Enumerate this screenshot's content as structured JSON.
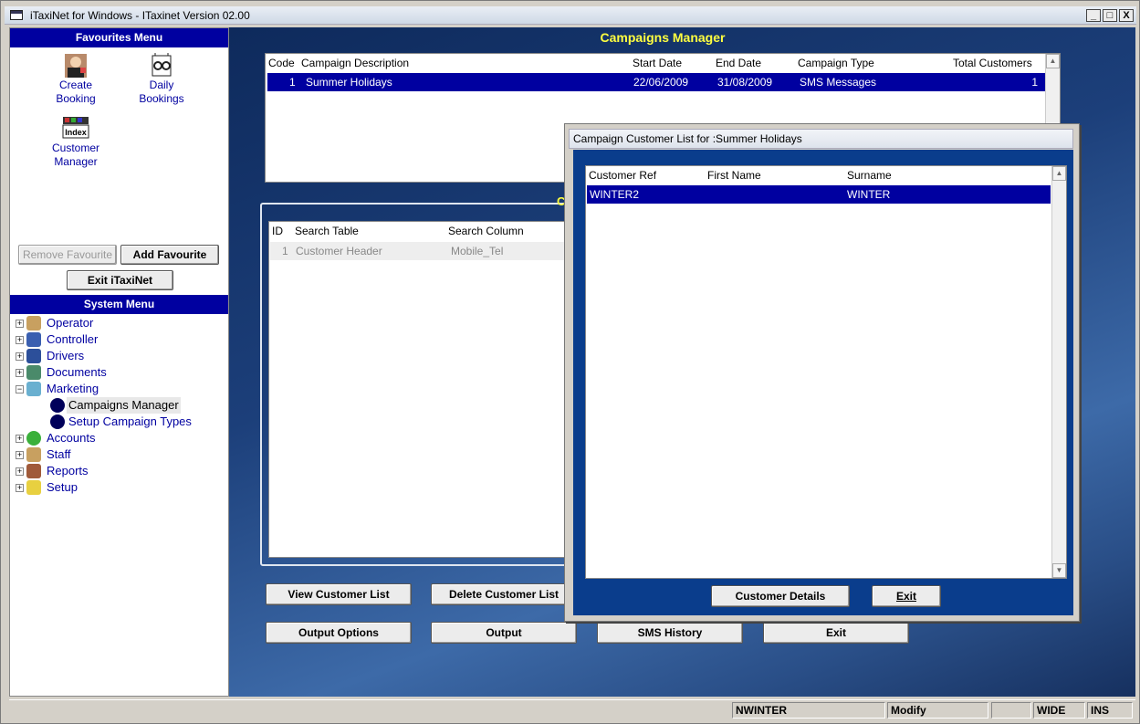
{
  "window": {
    "title": "iTaxiNet for Windows - ITaxinet Version 02.00",
    "min": "_",
    "max": "□",
    "close": "X"
  },
  "favourites": {
    "header": "Favourites Menu",
    "items": [
      {
        "label1": "Create",
        "label2": "Booking"
      },
      {
        "label1": "Daily",
        "label2": "Bookings"
      },
      {
        "label1": "Customer",
        "label2": "Manager",
        "icon_text": "Index"
      }
    ],
    "remove_label": "Remove Favourite",
    "add_label": "Add Favourite",
    "exit_label": "Exit iTaxiNet"
  },
  "system_menu": {
    "header": "System Menu",
    "items": [
      {
        "label": "Operator"
      },
      {
        "label": "Controller"
      },
      {
        "label": "Drivers"
      },
      {
        "label": "Documents"
      },
      {
        "label": "Marketing"
      },
      {
        "label": "Campaigns Manager"
      },
      {
        "label": "Setup Campaign Types"
      },
      {
        "label": "Accounts"
      },
      {
        "label": "Staff"
      },
      {
        "label": "Reports"
      },
      {
        "label": "Setup"
      }
    ]
  },
  "main": {
    "title": "Campaigns Manager",
    "campaigns": {
      "headers": [
        "Code",
        "Campaign Description",
        "Start Date",
        "End Date",
        "Campaign Type",
        "Total Customers"
      ],
      "rows": [
        {
          "code": "1",
          "desc": "Summer Holidays",
          "start": "22/06/2009",
          "end": "31/08/2009",
          "type": "SMS Messages",
          "total": "1"
        }
      ]
    },
    "criteria_label_fragment": "C",
    "criteria": {
      "headers": [
        "ID",
        "Search Table",
        "Search Column"
      ],
      "rows": [
        {
          "id": "1",
          "table": "Customer Header",
          "column": "Mobile_Tel"
        }
      ]
    },
    "buttons": {
      "view": "View Customer List",
      "delete": "Delete Customer List",
      "output_options": "Output Options",
      "output": "Output",
      "sms_history": "SMS History",
      "exit": "Exit"
    }
  },
  "dialog": {
    "title": "Campaign Customer List for :Summer Holidays",
    "headers": [
      "Customer Ref",
      "First Name",
      "Surname"
    ],
    "rows": [
      {
        "ref": "WINTER2",
        "first": "",
        "surname": "WINTER"
      }
    ],
    "details_label": "Customer Details",
    "exit_label": "Exit"
  },
  "status": {
    "user": "NWINTER",
    "mode": "Modify",
    "blank": "",
    "wide": "WIDE",
    "ins": "INS"
  },
  "colors": {
    "header_blue": "#0000a0",
    "title_yellow": "#ffff40",
    "selection": "#0000a0"
  }
}
